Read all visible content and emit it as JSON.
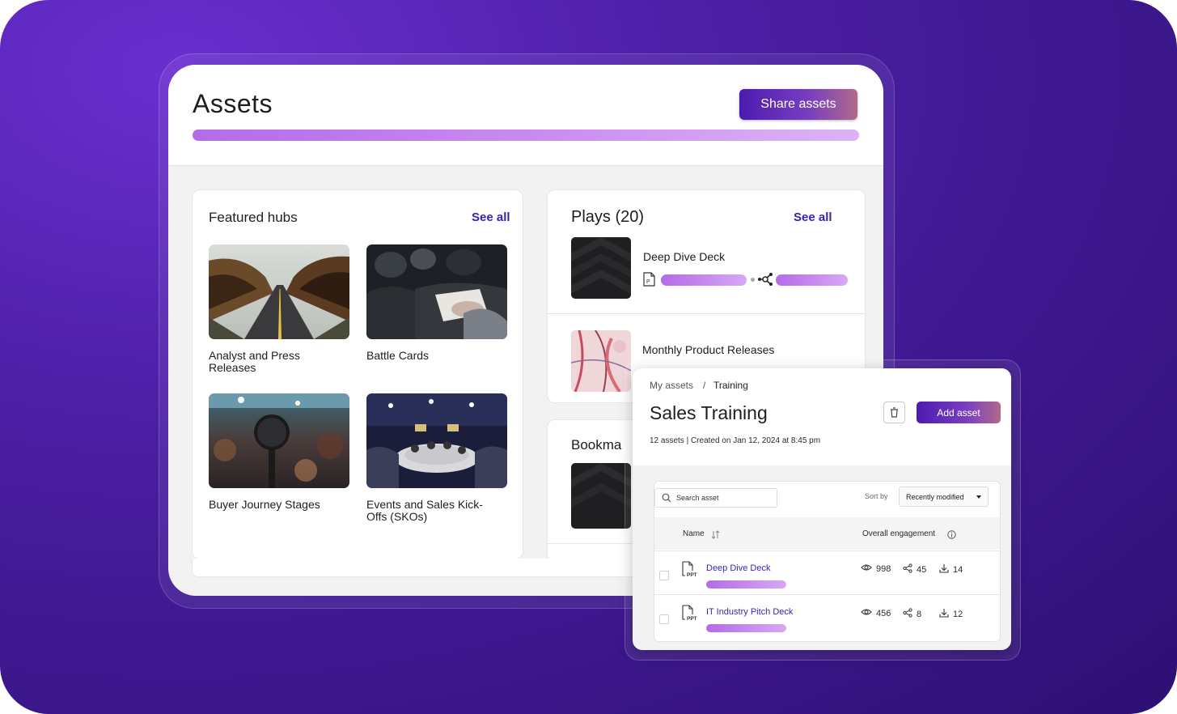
{
  "assets": {
    "title": "Assets",
    "share_label": "Share assets"
  },
  "featured": {
    "title": "Featured hubs",
    "see_all": "See all",
    "hubs": [
      {
        "label": "Analyst and Press Releases"
      },
      {
        "label": "Battle Cards"
      },
      {
        "label": "Buyer Journey Stages"
      },
      {
        "label": "Events and Sales Kick-Offs (SKOs)"
      }
    ]
  },
  "plays": {
    "title": "Plays (20)",
    "see_all": "See all",
    "items": [
      {
        "name": "Deep Dive Deck"
      },
      {
        "name": "Monthly Product Releases"
      }
    ]
  },
  "bookmarks": {
    "title": "Bookma"
  },
  "training": {
    "breadcrumb": [
      "My assets",
      "/",
      "Training"
    ],
    "title": "Sales Training",
    "add_label": "Add asset",
    "meta": "12 assets | Created on Jan 12, 2024 at 8:45 pm",
    "search_placeholder": "Search asset",
    "sort_label": "Sort by",
    "sort_value": "Recently modified",
    "columns": {
      "name": "Name",
      "engagement": "Overall engagement"
    },
    "rows": [
      {
        "file_type": "PPT",
        "name": "Deep Dive Deck",
        "views": "998",
        "shares": "45",
        "downloads": "14"
      },
      {
        "file_type": "PPT",
        "name": "IT Industry Pitch Deck",
        "views": "456",
        "shares": "8",
        "downloads": "12"
      }
    ]
  },
  "colors": {
    "accent": "#3d1fb0",
    "background": "#4a1ea3",
    "progress": "#b46be8"
  }
}
